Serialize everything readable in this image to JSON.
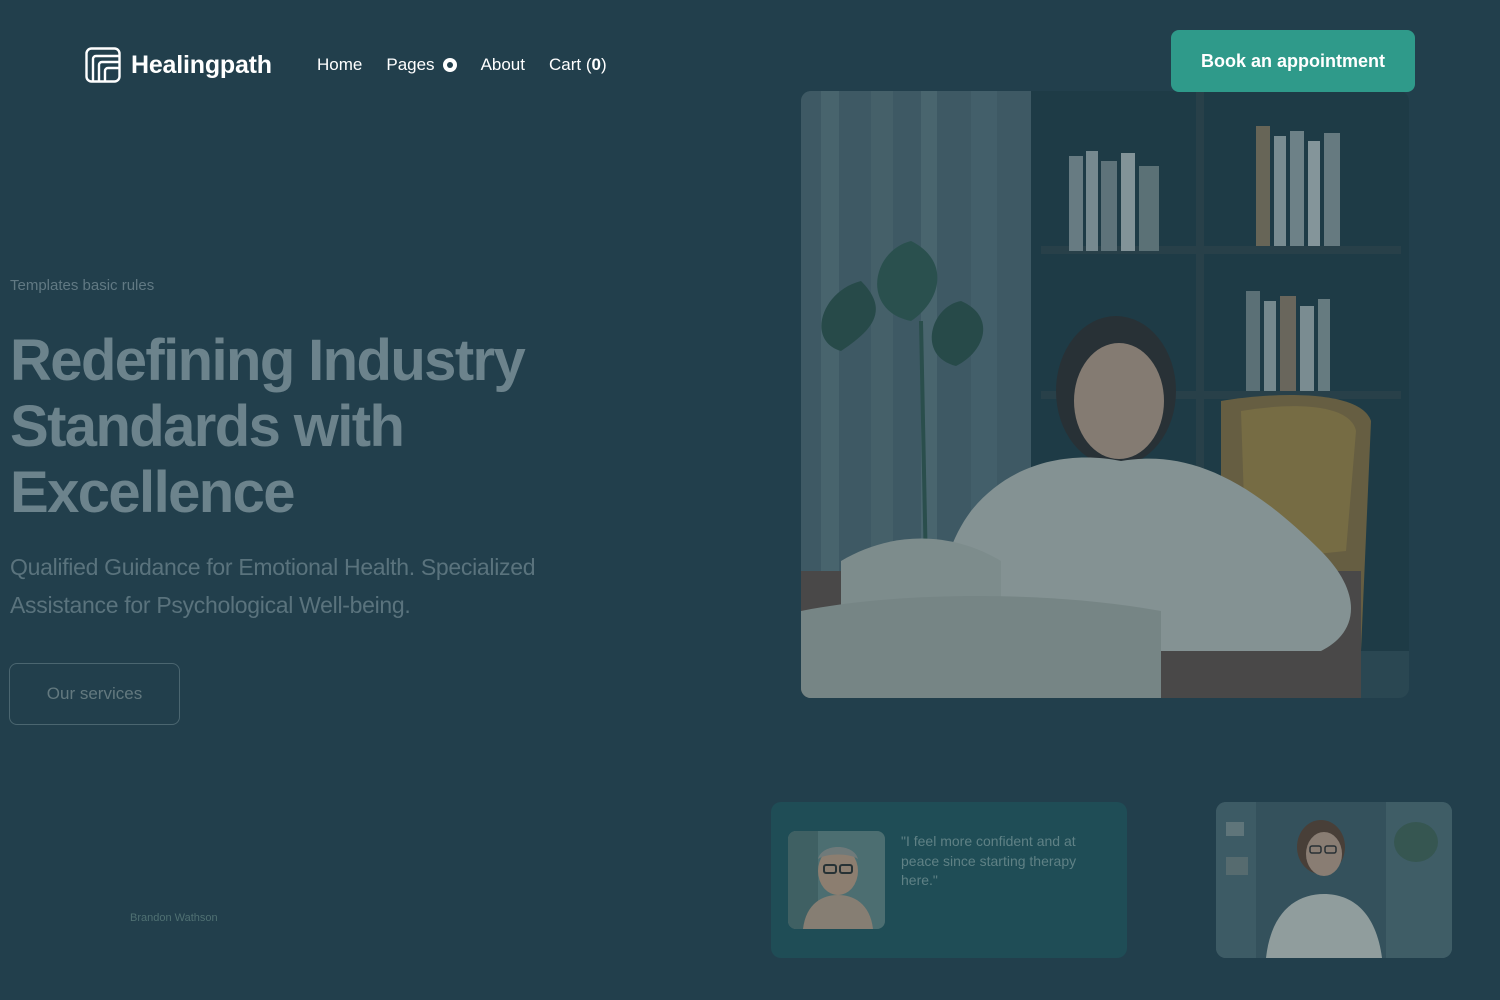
{
  "header": {
    "brand": "Healingpath",
    "nav": {
      "home": "Home",
      "pages": "Pages",
      "about": "About",
      "cart_label": "Cart (",
      "cart_count": "0",
      "cart_close": ")"
    },
    "cta": "Book an appointment"
  },
  "hero": {
    "eyebrow": "Templates basic rules",
    "headline": "Redefining Industry Standards with Excellence",
    "subheadline": "Qualified Guidance for Emotional Health. Specialized Assistance for Psychological Well-being.",
    "button": "Our services"
  },
  "testimonial": {
    "quote": "\"I feel more confident and at peace since starting therapy here.\"",
    "author": "Brandon Wathson"
  },
  "colors": {
    "background": "#223f4c",
    "accent": "#2f9a8a",
    "card": "#1f4d56"
  },
  "icons": {
    "logo": "rounded-square-lines-logo-icon",
    "pages_indicator": "dropdown-dot-icon"
  }
}
